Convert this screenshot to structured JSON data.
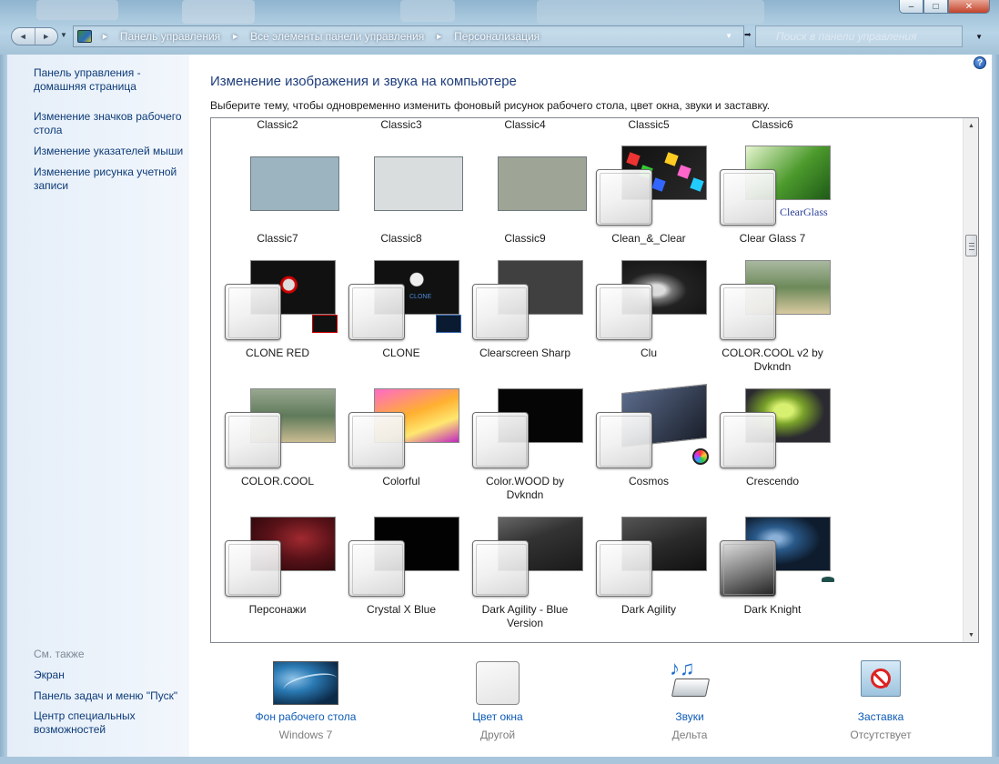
{
  "window": {
    "controls": {
      "minimize": "–",
      "maximize": "□",
      "close": "✕"
    }
  },
  "navigation": {
    "back": "◄",
    "forward": "►",
    "recent": "▼",
    "breadcrumb": [
      "Панель управления",
      "Все элементы панели управления",
      "Персонализация"
    ],
    "separator": "►",
    "dropdown": "▼",
    "refresh": "➡",
    "search_placeholder": "Поиск в панели управления"
  },
  "sidebar": {
    "links": [
      "Панель управления -\nдомашняя страница",
      "Изменение значков рабочего\nстола",
      "Изменение указателей мыши",
      "Изменение рисунка учетной\nзаписи"
    ],
    "see_also_title": "См. также",
    "see_also": [
      "Экран",
      "Панель задач и меню \"Пуск\"",
      "Центр специальных\nвозможностей"
    ]
  },
  "main": {
    "help": "?",
    "title": "Изменение изображения и звука на компьютере",
    "description": "Выберите тему, чтобы одновременно изменить фоновый рисунок рабочего стола, цвет окна, звуки и заставку."
  },
  "gallery": {
    "top_captions": [
      "Classic2",
      "Classic3",
      "Classic4",
      "Classic5",
      "Classic6"
    ],
    "themes": [
      {
        "name": "Classic7",
        "style": "flat",
        "color": "#9bb4bf"
      },
      {
        "name": "Classic8",
        "style": "flat",
        "color": "#d9dddd"
      },
      {
        "name": "Classic9",
        "style": "flat",
        "color": "#9ea596"
      },
      {
        "name": "Clean_&_Clear",
        "style": "tile",
        "color": "#b8262e"
      },
      {
        "name": "Clear Glass 7",
        "style": "tile",
        "color": "#5ea83a"
      },
      {
        "name": "CLONE RED",
        "style": "tile",
        "color": "#1a0505"
      },
      {
        "name": "CLONE",
        "style": "tile",
        "color": "#061428"
      },
      {
        "name": "Clearscreen Sharp",
        "style": "tile",
        "color": "#404040"
      },
      {
        "name": "Clu",
        "style": "tile",
        "color": "#2a2a2a"
      },
      {
        "name": "COLOR.COOL v2 by\nDvkndn",
        "style": "tile",
        "color": "#6f8a5c"
      },
      {
        "name": "COLOR.COOL",
        "style": "tile",
        "color": "#5f7a5a"
      },
      {
        "name": "Colorful",
        "style": "tile",
        "color": "#f0a020"
      },
      {
        "name": "Color.WOOD by\nDvkndn",
        "style": "tile",
        "color": "#050505"
      },
      {
        "name": "Cosmos",
        "style": "tile",
        "color": "#2c3c52"
      },
      {
        "name": "Crescendo",
        "style": "tile",
        "color": "#6a8a2a"
      },
      {
        "name": "Персонажи",
        "style": "tile",
        "color": "#5a1218"
      },
      {
        "name": "Crystal X Blue",
        "style": "tile",
        "color": "#020202"
      },
      {
        "name": "Dark Agility - Blue\nVersion",
        "style": "tile",
        "color": "#3a3d42"
      },
      {
        "name": "Dark Agility",
        "style": "tile",
        "color": "#2a2a2a"
      },
      {
        "name": "Dark Knight",
        "style": "tile",
        "color": "#16283e"
      }
    ],
    "clear_glass_label": "ClearGlass",
    "clone_badge": "CLONE",
    "scroll_up": "▲",
    "scroll_down": "▼"
  },
  "bottom": {
    "items": [
      {
        "label": "Фон рабочего стола",
        "value": "Windows 7"
      },
      {
        "label": "Цвет окна",
        "value": "Другой"
      },
      {
        "label": "Звуки",
        "value": "Дельта"
      },
      {
        "label": "Заставка",
        "value": "Отсутствует"
      }
    ]
  }
}
